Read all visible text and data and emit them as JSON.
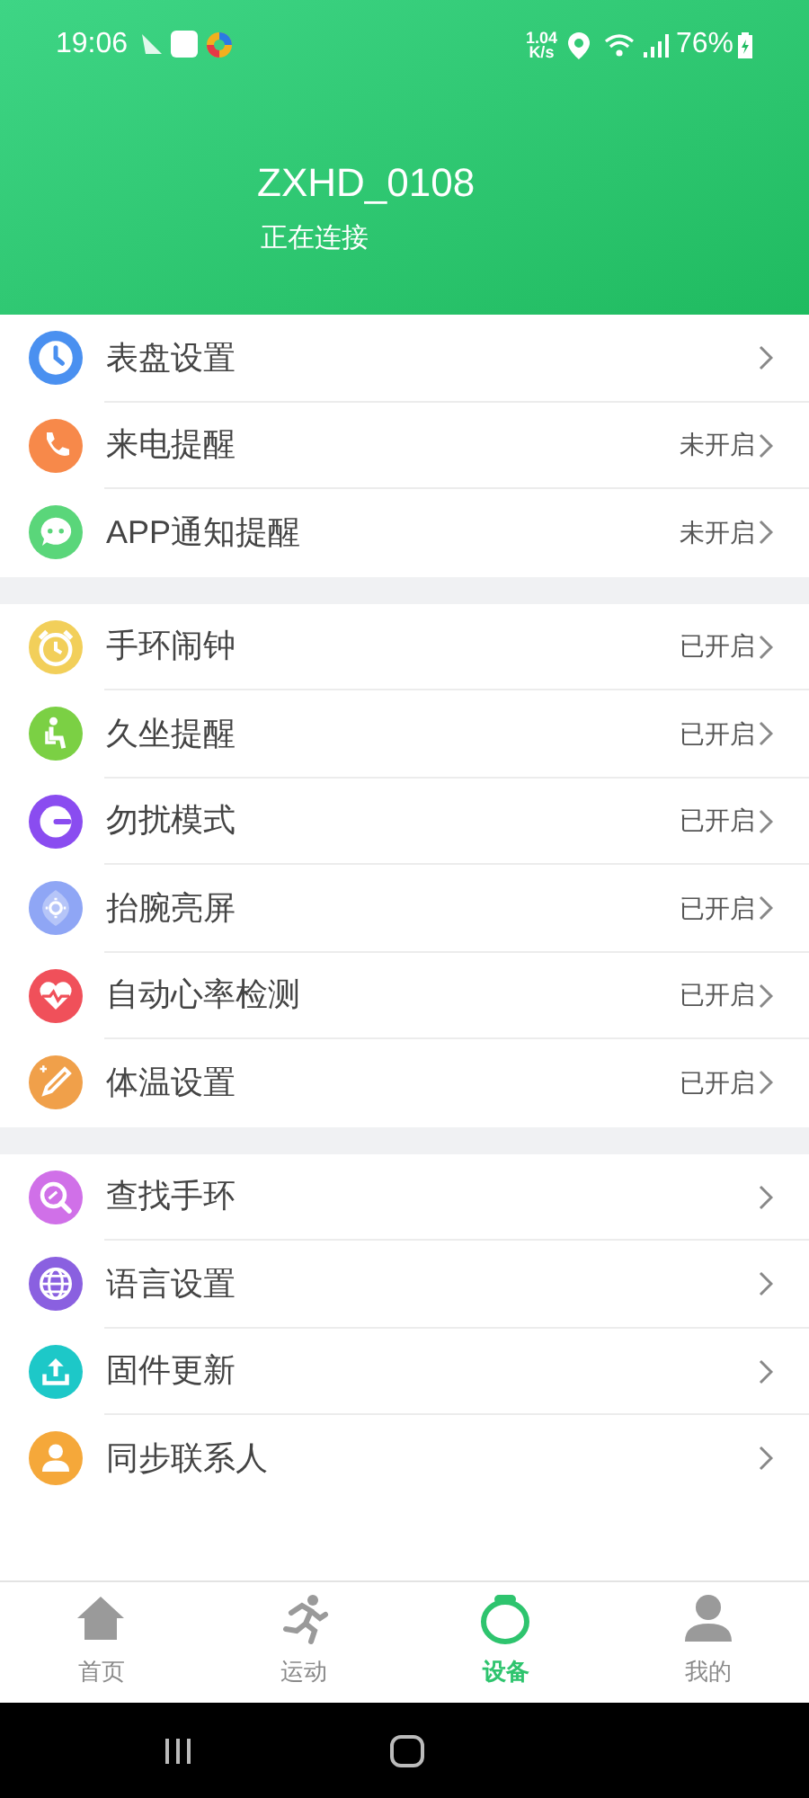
{
  "status_bar": {
    "time": "19:06",
    "speed_value": "1.04",
    "speed_unit": "K/s",
    "battery": "76%"
  },
  "device": {
    "name": "ZXHD_0108",
    "status": "正在连接"
  },
  "groups": [
    {
      "items": [
        {
          "label": "表盘设置",
          "color": "#4a90f0"
        },
        {
          "label": "来电提醒",
          "status": "未开启",
          "color": "#f7894a"
        },
        {
          "label": "APP通知提醒",
          "status": "未开启",
          "color": "#5ad67a"
        }
      ]
    },
    {
      "items": [
        {
          "label": "手环闹钟",
          "status": "已开启",
          "color": "#f2cf5a"
        },
        {
          "label": "久坐提醒",
          "status": "已开启",
          "color": "#7bd044"
        },
        {
          "label": "勿扰模式",
          "status": "已开启",
          "color": "#8a4cf0"
        },
        {
          "label": "抬腕亮屏",
          "status": "已开启",
          "color": "#8fa6f5"
        },
        {
          "label": "自动心率检测",
          "status": "已开启",
          "color": "#f0505a"
        },
        {
          "label": "体温设置",
          "status": "已开启",
          "color": "#f0a04a"
        }
      ]
    },
    {
      "items": [
        {
          "label": "查找手环",
          "color": "#d070e8"
        },
        {
          "label": "语言设置",
          "color": "#8a60e0"
        },
        {
          "label": "固件更新",
          "color": "#1dc8c8"
        },
        {
          "label": "同步联系人",
          "color": "#f5a83a"
        }
      ]
    }
  ],
  "tabs": [
    {
      "label": "首页",
      "selected": false
    },
    {
      "label": "运动",
      "selected": false
    },
    {
      "label": "设备",
      "selected": true
    },
    {
      "label": "我的",
      "selected": false
    }
  ]
}
